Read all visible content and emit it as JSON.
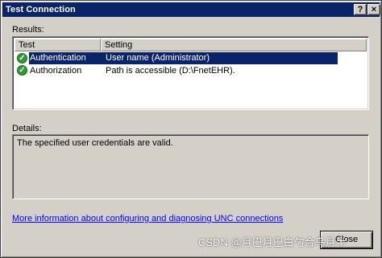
{
  "window": {
    "title": "Test Connection",
    "help_button": "?",
    "close_button": "×"
  },
  "results": {
    "label": "Results:",
    "columns": [
      "Test",
      "Setting"
    ],
    "rows": [
      {
        "test": "Authentication",
        "setting": "User name (Administrator)",
        "status_icon": "success-check-icon",
        "selected": true
      },
      {
        "test": "Authorization",
        "setting": "Path is accessible (D:\\FnetEHR).",
        "status_icon": "success-check-icon",
        "selected": false
      }
    ]
  },
  "details": {
    "label": "Details:",
    "text": "The specified user credentials are valid."
  },
  "link": {
    "text": "More information about configuring and diagnosing UNC connections"
  },
  "buttons": {
    "close_label": "Close"
  },
  "watermark": {
    "text": "CSDN @月巴月巴白勺合鸟月半"
  },
  "colors": {
    "titlebar": "#0a246a",
    "selection": "#0a246a",
    "face": "#d4d0c8",
    "link": "#0000ff",
    "success": "#2f9a35"
  }
}
